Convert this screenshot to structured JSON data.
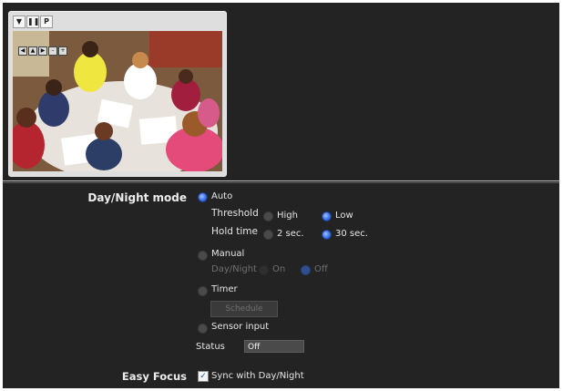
{
  "viewer": {
    "toolbar": [
      "▼",
      "❚❚",
      "P"
    ],
    "ptz_controls": [
      "◀",
      "▲",
      "▶",
      "–",
      "+"
    ]
  },
  "day_night": {
    "label": "Day/Night mode",
    "auto": "Auto",
    "threshold_label": "Threshold",
    "threshold_high": "High",
    "threshold_low": "Low",
    "hold_label": "Hold time",
    "hold_2": "2 sec.",
    "hold_30": "30 sec.",
    "manual": "Manual",
    "manual_sub_label": "Day/Night",
    "manual_on": "On",
    "manual_off": "Off",
    "timer": "Timer",
    "schedule_button": "Schedule",
    "sensor": "Sensor input",
    "status_label": "Status",
    "status_value": "Off"
  },
  "easy_focus": {
    "label": "Easy Focus",
    "sync": "Sync with Day/Night"
  }
}
